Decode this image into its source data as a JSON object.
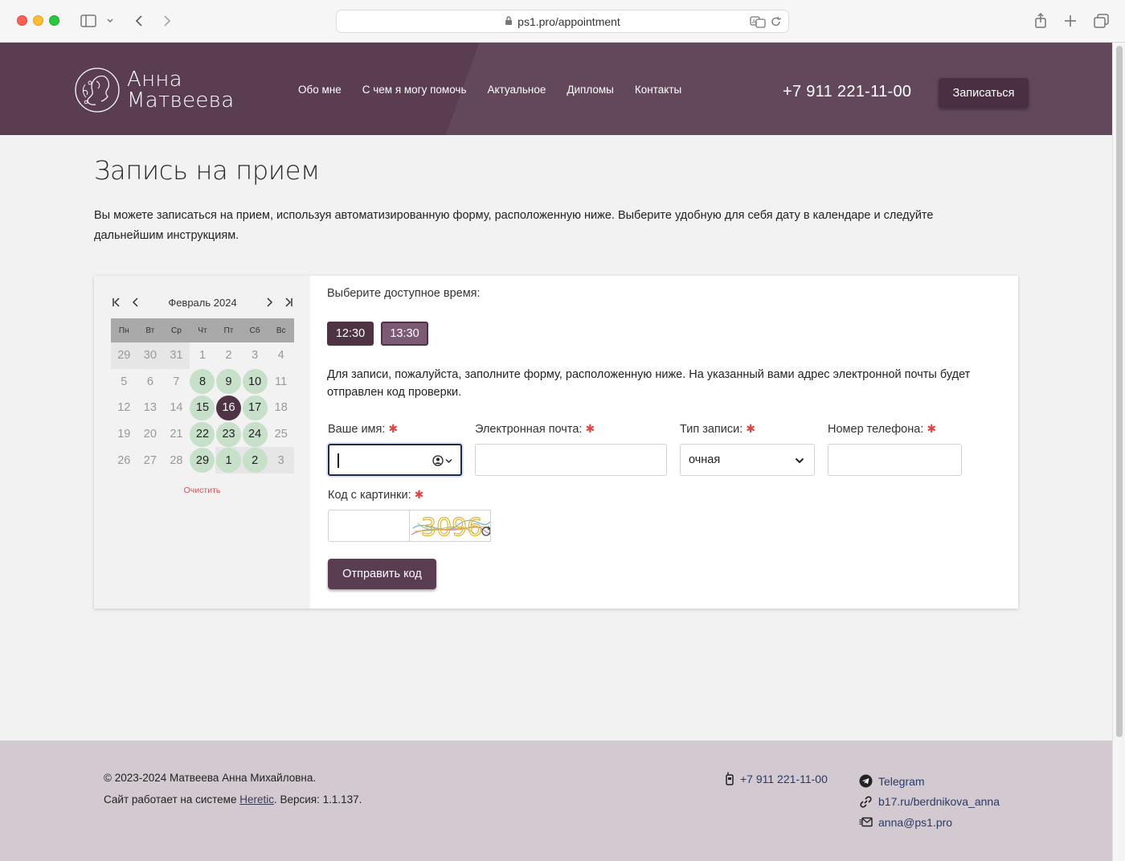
{
  "browser": {
    "url": "ps1.pro/appointment"
  },
  "header": {
    "logo_line1": "Анна",
    "logo_line2": "Матвеева",
    "nav": [
      "Обо мне",
      "С чем я могу помочь",
      "Актуальное",
      "Дипломы",
      "Контакты"
    ],
    "phone": "+7 911 221-11-00",
    "cta_label": "Записаться",
    "bg_color": "#5b3d52"
  },
  "page": {
    "title": "Запись на прием",
    "intro": "Вы можете записаться на прием, используя автоматизированную форму, расположенную ниже. Выберите удобную для себя дату в календаре и следуйте дальнейшим инструкциям."
  },
  "calendar": {
    "month_label": "Февраль 2024",
    "dow": [
      "Пн",
      "Вт",
      "Ср",
      "Чт",
      "Пт",
      "Сб",
      "Вс"
    ],
    "weeks": [
      [
        {
          "d": "29",
          "s": "other"
        },
        {
          "d": "30",
          "s": "other"
        },
        {
          "d": "31",
          "s": "other"
        },
        {
          "d": "1",
          "s": ""
        },
        {
          "d": "2",
          "s": ""
        },
        {
          "d": "3",
          "s": ""
        },
        {
          "d": "4",
          "s": ""
        }
      ],
      [
        {
          "d": "5",
          "s": ""
        },
        {
          "d": "6",
          "s": ""
        },
        {
          "d": "7",
          "s": ""
        },
        {
          "d": "8",
          "s": "avail"
        },
        {
          "d": "9",
          "s": "avail"
        },
        {
          "d": "10",
          "s": "avail"
        },
        {
          "d": "11",
          "s": ""
        }
      ],
      [
        {
          "d": "12",
          "s": ""
        },
        {
          "d": "13",
          "s": ""
        },
        {
          "d": "14",
          "s": ""
        },
        {
          "d": "15",
          "s": "avail"
        },
        {
          "d": "16",
          "s": "sel"
        },
        {
          "d": "17",
          "s": "avail"
        },
        {
          "d": "18",
          "s": ""
        }
      ],
      [
        {
          "d": "19",
          "s": ""
        },
        {
          "d": "20",
          "s": ""
        },
        {
          "d": "21",
          "s": ""
        },
        {
          "d": "22",
          "s": "avail"
        },
        {
          "d": "23",
          "s": "avail"
        },
        {
          "d": "24",
          "s": "avail"
        },
        {
          "d": "25",
          "s": ""
        }
      ],
      [
        {
          "d": "26",
          "s": ""
        },
        {
          "d": "27",
          "s": ""
        },
        {
          "d": "28",
          "s": ""
        },
        {
          "d": "29",
          "s": "avail"
        },
        {
          "d": "1",
          "s": "avail other"
        },
        {
          "d": "2",
          "s": "avail other"
        },
        {
          "d": "3",
          "s": "other"
        }
      ]
    ],
    "clear_label": "Очистить",
    "available_color": "#c6e0c9",
    "selected_color": "#4e3345"
  },
  "form": {
    "time_label": "Выберите доступное время:",
    "times": [
      "12:30",
      "13:30"
    ],
    "note": "Для записи, пожалуйста, заполните форму, расположенную ниже. На указанный вами адрес электронной почты будет отправлен код проверки.",
    "name_label": "Ваше имя:",
    "name_value": "",
    "email_label": "Электронная почта:",
    "email_value": "",
    "type_label": "Тип записи:",
    "type_value": "очная",
    "phone_label": "Номер телефона:",
    "phone_value": "",
    "captcha_label": "Код с картинки:",
    "captcha_value": "",
    "captcha_text": "3096",
    "submit_label": "Отправить код",
    "required_mark": "✱"
  },
  "footer": {
    "copyright": "© 2023-2024 Матвеева Анна Михайловна.",
    "system_prefix": "Сайт работает на системе ",
    "system_link": "Heretic",
    "system_suffix": ". Версия: 1.1.137.",
    "phone": "+7 911 221-11-00",
    "telegram": "Telegram",
    "link": "b17.ru/berdnikova_anna",
    "email": "anna@ps1.pro"
  }
}
